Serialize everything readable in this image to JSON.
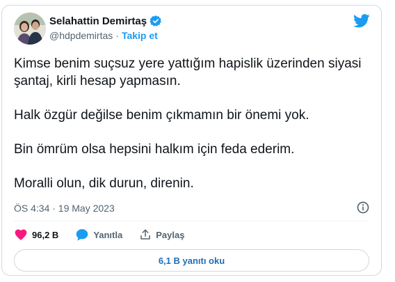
{
  "author": {
    "name": "Selahattin Demirtaş",
    "handle": "@hdpdemirtas",
    "separator": "·",
    "follow_label": "Takip et"
  },
  "tweet": {
    "paragraphs": [
      "Kimse benim suçsuz yere yattığım hapislik üzerinden siyasi şantaj, kirli hesap yapmasın.",
      "Halk özgür değilse benim çıkmamın bir önemi yok.",
      "Bin ömrüm olsa hepsini halkım için feda ederim.",
      "Moralli olun, dik durun, direnin."
    ],
    "timestamp": "ÖS 4:34 · 19 May 2023"
  },
  "actions": {
    "likes": "96,2 B",
    "reply_label": "Yanıtla",
    "share_label": "Paylaş"
  },
  "replies_button": "6,1 B yanıtı oku",
  "colors": {
    "accent": "#1d9bf0",
    "like": "#f91880",
    "verified": "#1d9bf0",
    "text_secondary": "#536471"
  },
  "icons": [
    "verified-badge-icon",
    "twitter-bird-icon",
    "info-icon",
    "heart-icon",
    "reply-bubble-icon",
    "share-icon"
  ]
}
